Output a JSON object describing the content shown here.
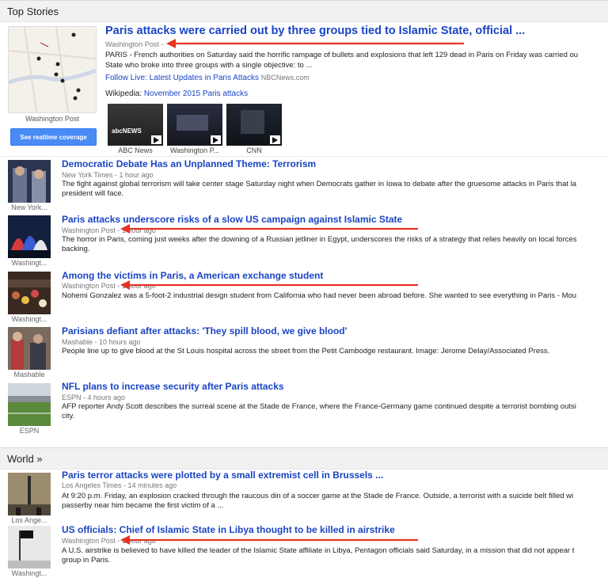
{
  "top_stories": {
    "header": "Top Stories",
    "thumb_source": "Washington Post",
    "realtime_button": "See realtime coverage",
    "title": "Paris attacks were carried out by three groups tied to Islamic State, official ...",
    "source": "Washington Post",
    "time_partial": "",
    "snippet_lines": [
      "PARIS - French authorities on Saturday said the horrific rampage of bullets and explosions that left 129 dead in Paris on Friday was carried ou",
      "State who broke into three groups with a single objective: to ..."
    ],
    "follow_link": "Follow Live: Latest Updates in Paris Attacks",
    "follow_source": "NBCNews.com",
    "wikipedia_label": "Wikipedia:",
    "wikipedia_link": "November 2015 Paris attacks",
    "videos": [
      {
        "caption": "ABC News"
      },
      {
        "caption": "Washington P..."
      },
      {
        "caption": "CNN"
      }
    ]
  },
  "stories": [
    {
      "title": "Democratic Debate Has an Unplanned Theme: Terrorism",
      "meta": "New York Times - 1 hour ago",
      "thumb_source": "New York...",
      "snippet_lines": [
        "The fight against global terrorism will take center stage Saturday night when Democrats gather in Iowa to debate after the gruesome attacks in Paris that la",
        "president will face."
      ]
    },
    {
      "title": "Paris attacks underscore risks of a slow US campaign against Islamic State",
      "meta": "Washington Post - 1 hour ago",
      "thumb_source": "Washingt...",
      "snippet_lines": [
        "The horror in Paris, coming just weeks after the downing of a Russian jetliner in Egypt, underscores the risks of a strategy that relies heavily on local forces",
        "backing."
      ]
    },
    {
      "title": "Among the victims in Paris, a American exchange student",
      "meta": "Washington Post - 1 hour ago",
      "thumb_source": "Washingt...",
      "snippet_lines": [
        "Nohemi Gonzalez was a 5-foot-2 industrial design student from California who had never been abroad before. She wanted to see everything in Paris - Mou"
      ]
    },
    {
      "title": "Parisians defiant after attacks: 'They spill blood, we give blood'",
      "meta": "Mashable - 10 hours ago",
      "thumb_source": "Mashable",
      "snippet_lines": [
        "People line up to give blood at the St Louis hospital across the street from the Petit Cambodge restaurant. Image: Jerome Delay/Associated Press."
      ]
    },
    {
      "title": "NFL plans to increase security after Paris attacks",
      "meta": "ESPN - 4 hours ago",
      "thumb_source": "ESPN",
      "snippet_lines": [
        "AFP reporter Andy Scott describes the surreal scene at the Stade de France, where the France-Germany game continued despite a terrorist bombing outsi",
        "city."
      ]
    }
  ],
  "world": {
    "header": "World »",
    "stories": [
      {
        "title": "Paris terror attacks were plotted by a small extremist cell in Brussels ...",
        "meta": "Los Angeles Times - 14 minutes ago",
        "thumb_source": "Los Ange...",
        "snippet_lines": [
          "At 9:20 p.m. Friday, an explosion cracked through the raucous din of a soccer game at the Stade de France. Outside, a terrorist with a suicide belt filled wi",
          "passerby near him became the first victim of a ..."
        ]
      },
      {
        "title": "US officials: Chief of Islamic State in Libya thought to be killed in airstrike",
        "meta": "Washington Post - 1 hour ago",
        "thumb_source": "Washingt...",
        "snippet_lines": [
          "A U.S. airstrike is believed to have killed the leader of the Islamic State affiliate in Libya, Pentagon officials said Saturday, in a mission that did not appear t",
          "group in Paris."
        ]
      }
    ]
  },
  "colors": {
    "link": "#1a44c4",
    "annotation_arrow": "#e53323",
    "realtime_button": "#4a8af4"
  }
}
